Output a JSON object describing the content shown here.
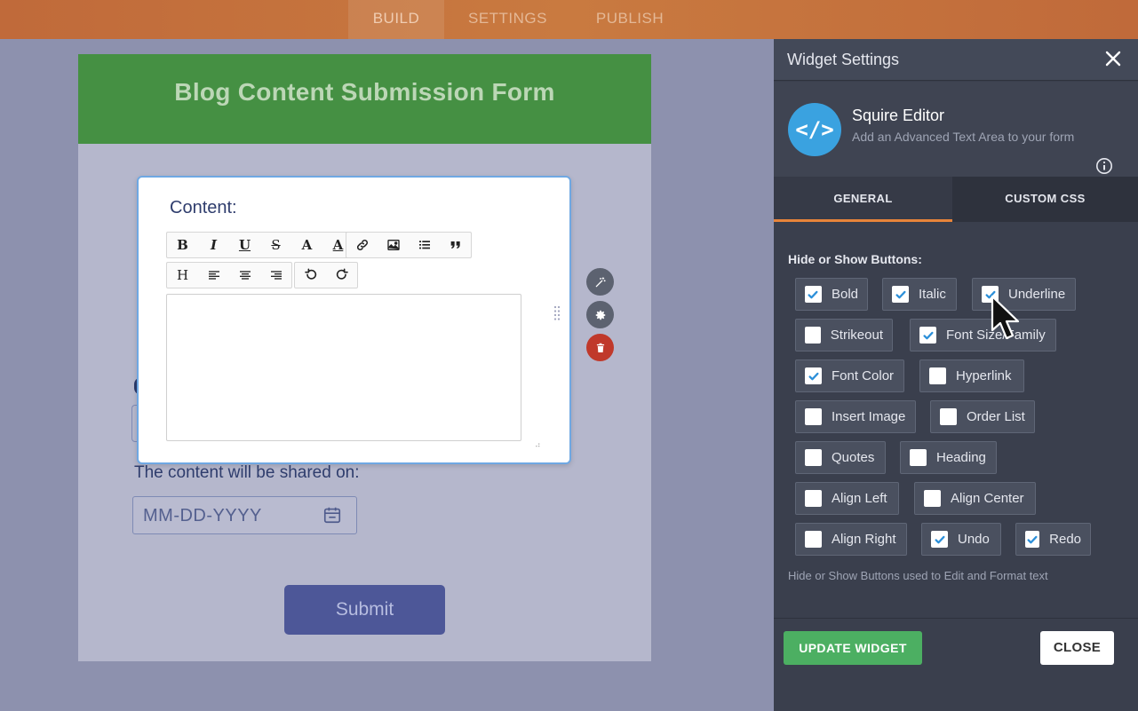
{
  "nav": {
    "tabs": [
      "BUILD",
      "SETTINGS",
      "PUBLISH"
    ],
    "active": "BUILD"
  },
  "form": {
    "title": "Blog Content Submission Form",
    "content_label": "Content:",
    "shared_label": "The content will be shared on:",
    "date_placeholder": "MM-DD-YYYY",
    "submit_label": "Submit"
  },
  "toolbar": {
    "row1": [
      {
        "name": "bold",
        "glyph": "B"
      },
      {
        "name": "italic",
        "glyph": "I"
      },
      {
        "name": "underline",
        "glyph": "U"
      },
      {
        "name": "strikeout",
        "glyph": "S"
      },
      {
        "name": "font-size",
        "glyph": "A"
      },
      {
        "name": "font-color",
        "glyph": "A"
      },
      {
        "name": "hyperlink",
        "glyph": "link"
      },
      {
        "name": "insert-image",
        "glyph": "image"
      },
      {
        "name": "order-list",
        "glyph": "list"
      },
      {
        "name": "quotes",
        "glyph": "quote"
      }
    ],
    "row2": [
      {
        "name": "heading",
        "glyph": "H"
      },
      {
        "name": "align-left",
        "glyph": "align-left"
      },
      {
        "name": "align-center",
        "glyph": "align-center"
      },
      {
        "name": "align-right",
        "glyph": "align-right"
      },
      {
        "name": "undo",
        "glyph": "undo"
      },
      {
        "name": "redo",
        "glyph": "redo"
      }
    ]
  },
  "panel": {
    "title": "Widget Settings",
    "widget_name": "Squire Editor",
    "widget_desc": "Add an Advanced Text Area to your form",
    "widget_icon": "</>",
    "tabs": [
      "GENERAL",
      "CUSTOM CSS"
    ],
    "active_tab": "GENERAL",
    "section_label": "Hide or Show Buttons:",
    "options": [
      {
        "label": "Bold",
        "checked": true
      },
      {
        "label": "Italic",
        "checked": true
      },
      {
        "label": "Underline",
        "checked": true
      },
      {
        "label": "Strikeout",
        "checked": false
      },
      {
        "label": "Font Size/Family",
        "checked": true
      },
      {
        "label": "Font Color",
        "checked": true
      },
      {
        "label": "Hyperlink",
        "checked": false
      },
      {
        "label": "Insert Image",
        "checked": false
      },
      {
        "label": "Order List",
        "checked": false
      },
      {
        "label": "Quotes",
        "checked": false
      },
      {
        "label": "Heading",
        "checked": false
      },
      {
        "label": "Align Left",
        "checked": false
      },
      {
        "label": "Align Center",
        "checked": false
      },
      {
        "label": "Align Right",
        "checked": false
      },
      {
        "label": "Undo",
        "checked": true
      },
      {
        "label": "Redo",
        "checked": true
      }
    ],
    "hint": "Hide or Show Buttons used to Edit and Format text",
    "update_label": "UPDATE WIDGET",
    "close_label": "CLOSE"
  },
  "colors": {
    "accent_orange": "#e8843a",
    "header_green": "#459043",
    "submit_blue": "#4d5798",
    "update_green": "#4caf62",
    "check_blue": "#2b8fd9",
    "delete_red": "#c0392b"
  }
}
